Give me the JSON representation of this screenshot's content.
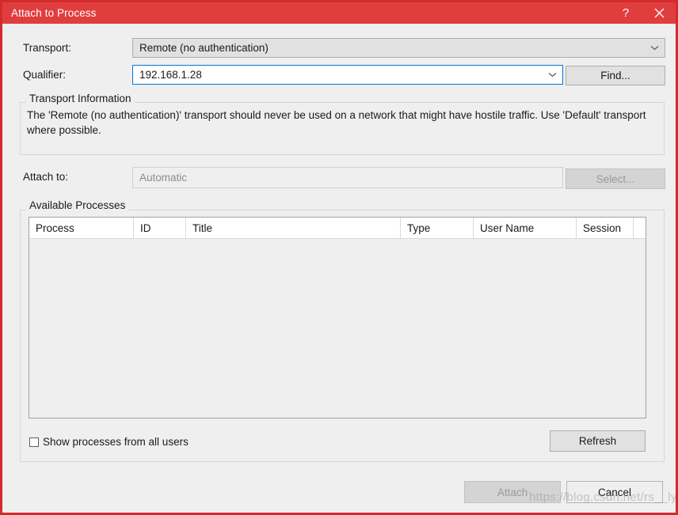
{
  "window": {
    "title": "Attach to Process",
    "help_icon": "question-mark-icon",
    "help_glyph": "?",
    "close_icon": "close-icon",
    "accent_color": "#e03e3e",
    "background_color": "#efefef"
  },
  "transport": {
    "label": "Transport:",
    "value": "Remote (no authentication)",
    "dropdown_icon": "chevron-down-icon"
  },
  "qualifier": {
    "label": "Qualifier:",
    "value": "192.168.1.28",
    "dropdown_icon": "chevron-down-icon",
    "focus_color": "#0078d7",
    "find_button": "Find..."
  },
  "transport_information": {
    "title": "Transport Information",
    "text": "The 'Remote (no authentication)' transport should never be used on a network that might have hostile traffic. Use 'Default' transport where possible."
  },
  "attach_to": {
    "label": "Attach to:",
    "value": "Automatic",
    "select_button": "Select...",
    "disabled": "true"
  },
  "available_processes": {
    "title": "Available Processes",
    "columns": [
      "Process",
      "ID",
      "Title",
      "Type",
      "User Name",
      "Session"
    ],
    "rows": [],
    "show_all_users_label": "Show processes from all users",
    "show_all_users_checked": "false",
    "refresh_button": "Refresh"
  },
  "footer": {
    "attach_button": "Attach",
    "cancel_button": "Cancel",
    "watermark": "https://blog.csdn.net/rs__lys"
  }
}
